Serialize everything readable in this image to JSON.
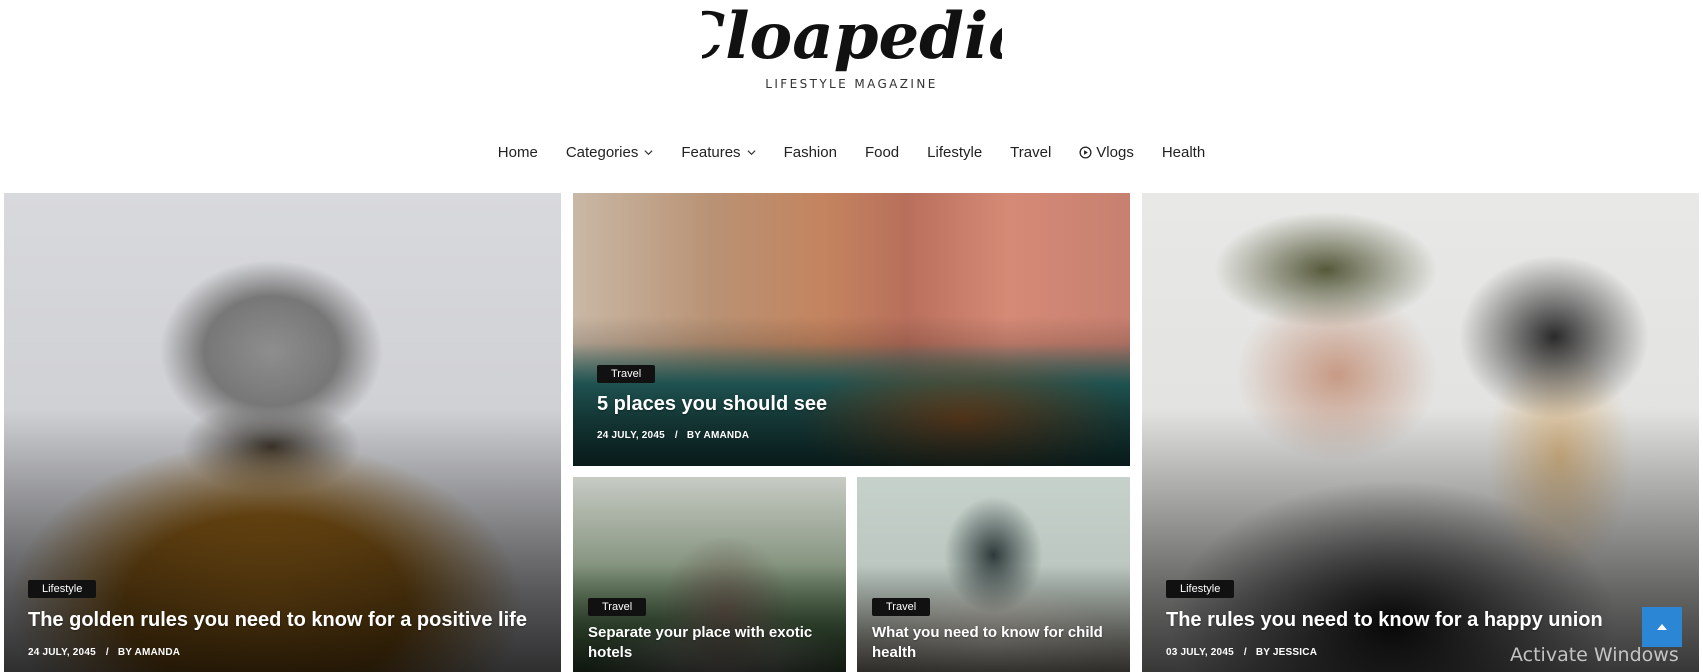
{
  "site": {
    "logo_text": "Cloapedia",
    "tagline": "LIFESTYLE MAGAZINE"
  },
  "nav": {
    "items": [
      {
        "label": "Home",
        "dropdown": false
      },
      {
        "label": "Categories",
        "dropdown": true
      },
      {
        "label": "Features",
        "dropdown": true
      },
      {
        "label": "Fashion",
        "dropdown": false
      },
      {
        "label": "Food",
        "dropdown": false
      },
      {
        "label": "Lifestyle",
        "dropdown": false
      },
      {
        "label": "Travel",
        "dropdown": false
      },
      {
        "label": "Vlogs",
        "dropdown": false,
        "icon": "play-circle-icon"
      },
      {
        "label": "Health",
        "dropdown": false
      }
    ]
  },
  "posts": [
    {
      "category": "Lifestyle",
      "title": "The golden rules you need to know for a positive life",
      "date": "24 JULY, 2045",
      "author": "BY AMANDA"
    },
    {
      "category": "Travel",
      "title": "5 places you should see",
      "date": "24 JULY, 2045",
      "author": "BY AMANDA"
    },
    {
      "category": "Travel",
      "title": "Separate your place with exotic hotels"
    },
    {
      "category": "Travel",
      "title": "What you need to know for child health"
    },
    {
      "category": "Lifestyle",
      "title": "The rules you need to know for a happy union",
      "date": "03 JULY, 2045",
      "author": "BY JESSICA"
    }
  ],
  "colors": {
    "badge_bg": "#111111",
    "back_to_top": "#2b86d6"
  },
  "back_to_top_icon": "chevron-up-icon",
  "os_watermark": "Activate Windows"
}
